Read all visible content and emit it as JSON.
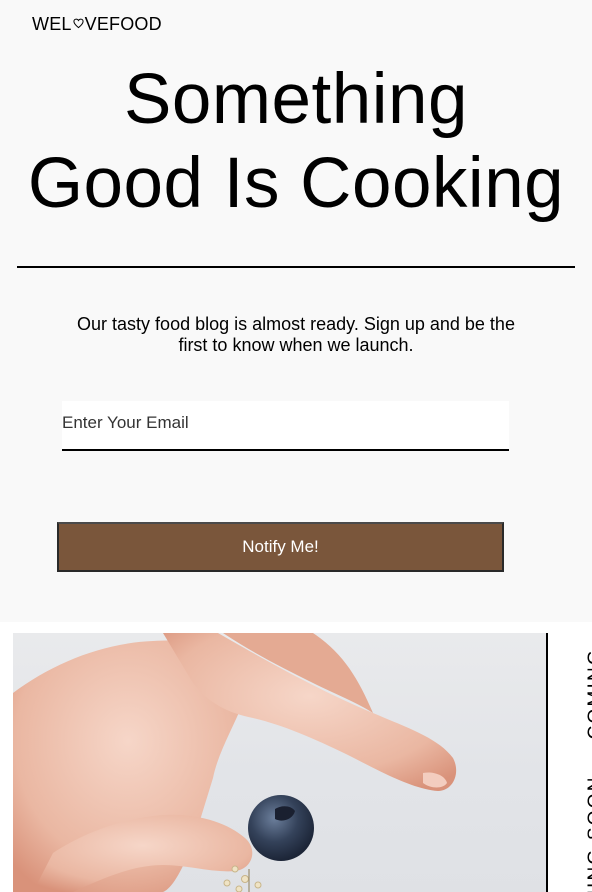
{
  "brand": {
    "prefix": "WEL",
    "suffix": "VEFOOD",
    "heart_icon": "heart-outline-icon"
  },
  "hero": {
    "title_line1": "Something",
    "title_line2": "Good Is Cooking"
  },
  "intro": {
    "text": "Our tasty food blog is almost ready. Sign up and be the first to know when we launch."
  },
  "signup": {
    "email_placeholder": "Enter Your Email",
    "email_value": "",
    "button_label": "Notify Me!"
  },
  "ticker": {
    "text_a": "OMING SOON",
    "text_b": "COMING"
  },
  "colors": {
    "background": "#f9f9f9",
    "button": "#7a563b",
    "text": "#000000"
  }
}
